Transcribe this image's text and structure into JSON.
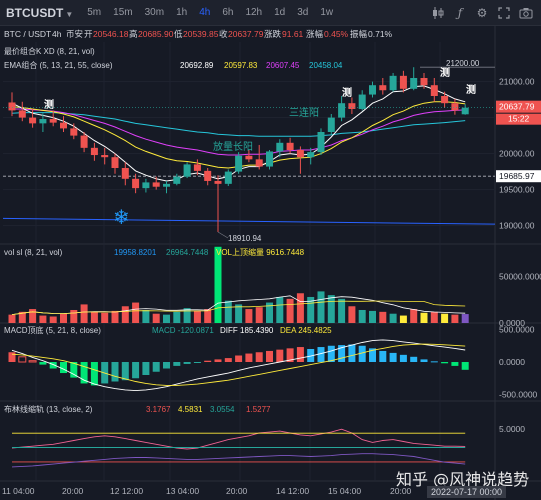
{
  "topbar": {
    "symbol": "BTCUSDT",
    "timeframes": [
      "5m",
      "15m",
      "30m",
      "1h",
      "4h",
      "6h",
      "12h",
      "1d",
      "3d",
      "1w"
    ],
    "active_timeframe": "4h"
  },
  "infobar": {
    "pair": "BTC / USDT",
    "interval": "4h",
    "exchange": "币安",
    "open_label": "开",
    "open": "20546.18",
    "high_label": "高",
    "high": "20685.90",
    "low_label": "低",
    "low": "20539.85",
    "close_label": "收",
    "close": "20637.79",
    "change_label": "涨跌",
    "change": "91.61",
    "pct_label": "涨幅",
    "pct": "0.45%",
    "amp_label": "振幅",
    "amp": "0.71%"
  },
  "legends": {
    "kxd": "最价组合K XD (8, 21, vol)",
    "ema": "EMA组合 (5, 13, 21, 55, close)",
    "ema_values": [
      "20692.89",
      "20597.83",
      "20607.45",
      "20458.04"
    ],
    "vol": "vol sl (8, 21, vol)",
    "vol_values": [
      "19958.8201",
      "26964.7448"
    ],
    "vol_extra": "VOL上顶缩量 9616.7448",
    "macd": "MACD顶底 (5, 21, 8, close)",
    "macd_macd": "MACD -120.0871",
    "macd_diff": "DIFF 185.4390",
    "macd_dea": "DEA 245.4825",
    "boll": "布林线缩轨 (13, close, 2)",
    "boll_values": [
      "3.1767",
      "4.5831",
      "3.0554",
      "1.5277"
    ]
  },
  "annotations": {
    "high_price": "21200.00",
    "low_price": "18910.94",
    "hline_price": "19685.97",
    "cur_price": "20637.79",
    "countdown": "15:22",
    "three_up": "三连阳",
    "vol_up": "放量长阳",
    "ce_marks": [
      "测",
      "测",
      "测",
      "测"
    ],
    "snowflake": "❄"
  },
  "colors": {
    "up": "#26a69a",
    "up_bright": "#00e676",
    "down": "#ef5350",
    "ema5": "#ffffff",
    "ema13": "#ffeb3b",
    "ema21": "#e040fb",
    "ema55": "#26c6da",
    "bg": "#161a25"
  },
  "watermark": "知乎 @风神说趋势",
  "datebox": "2022-07-17 00:00",
  "chart_data": [
    {
      "type": "candlestick",
      "title": "BTC / USDT 4h",
      "ylim": [
        18800,
        21550
      ],
      "y_ticks": [
        "21000.00",
        "20500.00",
        "20000.00",
        "19500.00",
        "19000.00"
      ],
      "x_ticks": [
        "11 04:00",
        "20:00",
        "12 12:00",
        "13 04:00",
        "20:00",
        "14 12:00",
        "15 04:00",
        "20:00"
      ],
      "ohlc": [
        [
          20710,
          20850,
          20520,
          20600
        ],
        [
          20600,
          20720,
          20450,
          20500
        ],
        [
          20500,
          20620,
          20360,
          20420
        ],
        [
          20420,
          20560,
          20300,
          20480
        ],
        [
          20480,
          20600,
          20380,
          20430
        ],
        [
          20430,
          20520,
          20300,
          20350
        ],
        [
          20350,
          20420,
          20200,
          20250
        ],
        [
          20250,
          20300,
          20020,
          20080
        ],
        [
          20080,
          20150,
          19900,
          19980
        ],
        [
          19980,
          20080,
          19850,
          19950
        ],
        [
          19950,
          20000,
          19720,
          19800
        ],
        [
          19800,
          19880,
          19560,
          19650
        ],
        [
          19650,
          19720,
          19450,
          19520
        ],
        [
          19520,
          19650,
          19460,
          19600
        ],
        [
          19600,
          19680,
          19500,
          19540
        ],
        [
          19540,
          19620,
          19450,
          19580
        ],
        [
          19580,
          19720,
          19560,
          19680
        ],
        [
          19680,
          19880,
          19660,
          19850
        ],
        [
          19850,
          19920,
          19700,
          19760
        ],
        [
          19760,
          19800,
          19560,
          19620
        ],
        [
          19620,
          19700,
          18911,
          19580
        ],
        [
          19580,
          19780,
          19550,
          19750
        ],
        [
          19750,
          20020,
          19720,
          19970
        ],
        [
          19970,
          20050,
          19880,
          19920
        ],
        [
          19920,
          20120,
          19780,
          19820
        ],
        [
          19820,
          20050,
          19780,
          20030
        ],
        [
          20030,
          20200,
          19950,
          20150
        ],
        [
          20150,
          20220,
          20000,
          20050
        ],
        [
          20050,
          20100,
          19720,
          19950
        ],
        [
          19950,
          20080,
          19850,
          20020
        ],
        [
          20020,
          20350,
          19980,
          20300
        ],
        [
          20300,
          20550,
          20260,
          20500
        ],
        [
          20500,
          20800,
          20450,
          20700
        ],
        [
          20700,
          20780,
          20550,
          20620
        ],
        [
          20620,
          20880,
          20600,
          20820
        ],
        [
          20820,
          21000,
          20780,
          20950
        ],
        [
          20950,
          21050,
          20820,
          20880
        ],
        [
          20880,
          21120,
          20860,
          21080
        ],
        [
          21080,
          21150,
          20850,
          20900
        ],
        [
          20900,
          21200,
          20880,
          21050
        ],
        [
          21050,
          21120,
          20900,
          20950
        ],
        [
          20950,
          21050,
          20720,
          20800
        ],
        [
          20800,
          20860,
          20640,
          20700
        ],
        [
          20700,
          20760,
          20540,
          20600
        ],
        [
          20546,
          20686,
          20540,
          20638
        ]
      ],
      "ema5": [
        20700,
        20630,
        20560,
        20530,
        20500,
        20450,
        20380,
        20280,
        20180,
        20100,
        20000,
        19880,
        19760,
        19700,
        19650,
        19620,
        19640,
        19710,
        19730,
        19690,
        19650,
        19680,
        19780,
        19820,
        19820,
        19890,
        19980,
        20000,
        19980,
        19990,
        20090,
        20230,
        20390,
        20470,
        20580,
        20700,
        20760,
        20860,
        20870,
        20930,
        20940,
        20890,
        20830,
        20760,
        20720
      ],
      "ema13": [
        20650,
        20640,
        20620,
        20600,
        20580,
        20550,
        20510,
        20450,
        20390,
        20330,
        20260,
        20180,
        20090,
        20030,
        19980,
        19930,
        19900,
        19890,
        19870,
        19840,
        19810,
        19800,
        19820,
        19840,
        19840,
        19870,
        19910,
        19930,
        19940,
        19950,
        20000,
        20070,
        20160,
        20220,
        20300,
        20390,
        20460,
        20540,
        20590,
        20660,
        20700,
        20720,
        20720,
        20710,
        20690
      ],
      "ema21": [
        20620,
        20620,
        20610,
        20600,
        20590,
        20570,
        20540,
        20500,
        20460,
        20420,
        20370,
        20310,
        20250,
        20200,
        20160,
        20120,
        20090,
        20070,
        20050,
        20020,
        19990,
        19980,
        19980,
        19990,
        19990,
        20000,
        20030,
        20040,
        20050,
        20050,
        20080,
        20120,
        20180,
        20220,
        20270,
        20330,
        20380,
        20440,
        20480,
        20530,
        20560,
        20580,
        20590,
        20600,
        20607
      ],
      "ema55": [
        20560,
        20570,
        20570,
        20570,
        20570,
        20560,
        20550,
        20540,
        20520,
        20500,
        20480,
        20450,
        20420,
        20400,
        20380,
        20360,
        20340,
        20320,
        20300,
        20290,
        20270,
        20260,
        20250,
        20250,
        20240,
        20240,
        20240,
        20240,
        20240,
        20240,
        20250,
        20260,
        20280,
        20290,
        20300,
        20320,
        20340,
        20360,
        20380,
        20400,
        20410,
        20420,
        20430,
        20445,
        20458
      ]
    },
    {
      "type": "bar",
      "title": "vol sl (8, 21, vol)",
      "ylim": [
        0,
        85000
      ],
      "y_ticks": [
        "50000.0000",
        "0.0000"
      ],
      "volume": [
        9000,
        12000,
        15000,
        8000,
        7000,
        10000,
        14000,
        20000,
        12000,
        11000,
        13000,
        18000,
        22000,
        14000,
        10000,
        9000,
        12000,
        16000,
        13000,
        15000,
        82000,
        24000,
        20000,
        15000,
        17000,
        22000,
        28000,
        26000,
        32000,
        28000,
        34000,
        30000,
        26000,
        18000,
        14000,
        13000,
        12000,
        10000,
        8000,
        15000,
        11000,
        12000,
        10000,
        9000,
        9616
      ],
      "colors": [
        "down",
        "down",
        "down",
        "down",
        "down",
        "down",
        "down",
        "down",
        "down",
        "down",
        "down",
        "down",
        "down",
        "up",
        "down",
        "up",
        "up",
        "up",
        "down",
        "down",
        "up_bright",
        "up",
        "up",
        "down",
        "down",
        "up",
        "up",
        "down",
        "down",
        "up",
        "up",
        "up",
        "up",
        "down",
        "up",
        "up",
        "down",
        "up",
        "down",
        "up",
        "down",
        "down",
        "down",
        "down",
        "up"
      ]
    },
    {
      "type": "bar",
      "title": "MACD顶底 (5, 21, 8, close)",
      "ylim": [
        -600,
        600
      ],
      "y_ticks": [
        "500.0000",
        "0.0000",
        "-500.0000"
      ],
      "macd": [
        150,
        80,
        20,
        -40,
        -100,
        -170,
        -240,
        -330,
        -360,
        -330,
        -300,
        -280,
        -250,
        -200,
        -150,
        -100,
        -60,
        -30,
        -10,
        20,
        40,
        60,
        100,
        130,
        150,
        170,
        190,
        210,
        230,
        200,
        230,
        250,
        260,
        270,
        250,
        210,
        170,
        140,
        110,
        80,
        40,
        10,
        -20,
        -60,
        -120
      ],
      "diff": [
        180,
        130,
        70,
        20,
        -40,
        -110,
        -190,
        -280,
        -340,
        -380,
        -410,
        -430,
        -440,
        -430,
        -410,
        -380,
        -340,
        -300,
        -260,
        -230,
        -200,
        -170,
        -130,
        -90,
        -60,
        -30,
        0,
        30,
        60,
        90,
        130,
        170,
        220,
        260,
        300,
        330,
        340,
        330,
        310,
        290,
        270,
        250,
        230,
        210,
        185
      ],
      "dea": [
        120,
        110,
        90,
        70,
        50,
        20,
        -20,
        -70,
        -120,
        -170,
        -220,
        -260,
        -300,
        -330,
        -350,
        -360,
        -360,
        -350,
        -340,
        -320,
        -300,
        -280,
        -250,
        -220,
        -190,
        -160,
        -130,
        -100,
        -70,
        -40,
        -10,
        20,
        60,
        100,
        140,
        180,
        210,
        240,
        260,
        270,
        275,
        272,
        265,
        256,
        245
      ]
    },
    {
      "type": "line",
      "title": "布林线缩轨 (13, close, 2)",
      "ylim": [
        -0.5,
        8
      ],
      "y_ticks": [
        "5.0000"
      ],
      "series": [
        {
          "name": "3.1767",
          "color": "#f06292",
          "values": [
            3.0,
            3.1,
            3.2,
            3.3,
            3.4,
            3.6,
            3.8,
            4.0,
            4.2,
            4.3,
            4.2,
            4.0,
            3.8,
            3.6,
            3.4,
            3.2,
            3.0,
            2.9,
            3.0,
            3.3,
            3.6,
            3.9,
            4.1,
            4.3,
            4.6,
            4.7,
            4.8,
            4.6,
            4.4,
            4.3,
            4.5,
            4.7,
            5.0,
            4.6,
            3.9,
            3.6,
            3.8,
            3.9,
            3.7,
            3.5,
            3.4,
            3.3,
            3.2,
            3.2,
            3.18
          ]
        },
        {
          "name": "4.5831",
          "color": "#ffeb3b",
          "values": [
            4.58,
            4.58,
            4.58,
            4.58,
            4.58,
            4.58,
            4.58,
            4.58,
            4.58,
            4.58,
            4.58,
            4.58,
            4.58,
            4.58,
            4.58,
            4.58,
            4.58,
            4.58,
            4.58,
            4.58,
            4.58,
            4.58,
            4.58,
            4.58,
            4.58,
            4.58,
            4.58,
            4.58,
            4.58,
            4.58,
            4.58,
            4.58,
            4.58,
            4.58,
            4.58,
            4.58,
            4.58,
            4.58,
            4.58,
            4.58,
            4.58,
            4.58,
            4.58,
            4.58,
            4.58
          ]
        },
        {
          "name": "3.0554",
          "color": "#26a69a",
          "values": [
            3.06,
            3.06,
            3.06,
            3.06,
            3.06,
            3.06,
            3.06,
            3.06,
            3.06,
            3.06,
            3.06,
            3.06,
            3.06,
            3.06,
            3.06,
            3.06,
            3.06,
            3.06,
            3.06,
            3.06,
            3.06,
            3.06,
            3.06,
            3.06,
            3.06,
            3.06,
            3.06,
            3.06,
            3.06,
            3.06,
            3.06,
            3.06,
            3.06,
            3.06,
            3.06,
            3.06,
            3.06,
            3.06,
            3.06,
            3.06,
            3.06,
            3.06,
            3.06,
            3.06,
            3.06
          ]
        },
        {
          "name": "1.5277",
          "color": "#ef5350",
          "values": [
            1.53,
            1.53,
            1.53,
            1.53,
            1.53,
            1.53,
            1.53,
            1.53,
            1.53,
            1.53,
            1.53,
            1.53,
            1.53,
            1.53,
            1.53,
            1.53,
            1.53,
            1.53,
            1.53,
            1.53,
            1.53,
            1.53,
            1.53,
            1.53,
            1.53,
            1.53,
            1.53,
            1.53,
            1.53,
            1.53,
            1.53,
            1.53,
            1.53,
            1.53,
            1.53,
            1.53,
            1.53,
            1.53,
            1.53,
            1.53,
            1.53,
            1.53,
            1.53,
            1.53,
            1.53
          ]
        },
        {
          "name": "",
          "color": "#7e57c2",
          "values": [
            1.0,
            1.05,
            1.1,
            1.2,
            1.3,
            1.4,
            1.5,
            1.6,
            1.7,
            1.8,
            1.9,
            1.95,
            2.0,
            2.0,
            1.95,
            1.9,
            1.85,
            1.8,
            1.8,
            1.85,
            1.9,
            1.95,
            2.0,
            2.05,
            2.1,
            2.15,
            2.2,
            2.2,
            2.15,
            2.1,
            2.15,
            2.2,
            2.3,
            2.35,
            2.4,
            2.4,
            2.35,
            2.3,
            2.2,
            2.1,
            1.9,
            1.7,
            1.5,
            1.4,
            1.3
          ]
        }
      ]
    }
  ]
}
